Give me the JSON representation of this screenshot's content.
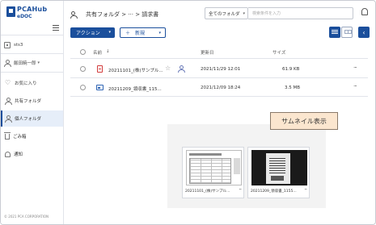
{
  "brand": {
    "logo_main": "PCAHub",
    "logo_sub": "eDOC"
  },
  "sidebar": {
    "tenant": "sts3",
    "user": "飯田暁一郎",
    "items": [
      {
        "label": "お気に入り"
      },
      {
        "label": "共有フォルダ"
      },
      {
        "label": "個人フォルダ"
      },
      {
        "label": "ごみ箱"
      },
      {
        "label": "通知"
      }
    ],
    "copyright": "© 2021 PCA CORPORATION"
  },
  "header": {
    "breadcrumb": "共有フォルダ > ··· > 請求書",
    "scope_select": "全てのフォルダ",
    "search_placeholder": "検索条件を入力"
  },
  "toolbar": {
    "action_label": "アクション",
    "new_label": "＋　新規"
  },
  "table": {
    "columns": {
      "name": "名前",
      "sort": "↓",
      "updated": "更新日",
      "size": "サイズ"
    },
    "rows": [
      {
        "name": "20211101_(株)サンプル...",
        "updated": "2021/11/29 12:01",
        "size": "61.9 KB",
        "type": "pdf"
      },
      {
        "name": "20211209_領収書_115...",
        "updated": "2021/12/09 18:24",
        "size": "3.5 MB",
        "type": "image"
      }
    ]
  },
  "thumbnail": {
    "label": "サムネイル表示",
    "cards": [
      {
        "caption": "20211101_(株)サンプル..."
      },
      {
        "caption": "20211209_領収書_1155..."
      }
    ]
  }
}
